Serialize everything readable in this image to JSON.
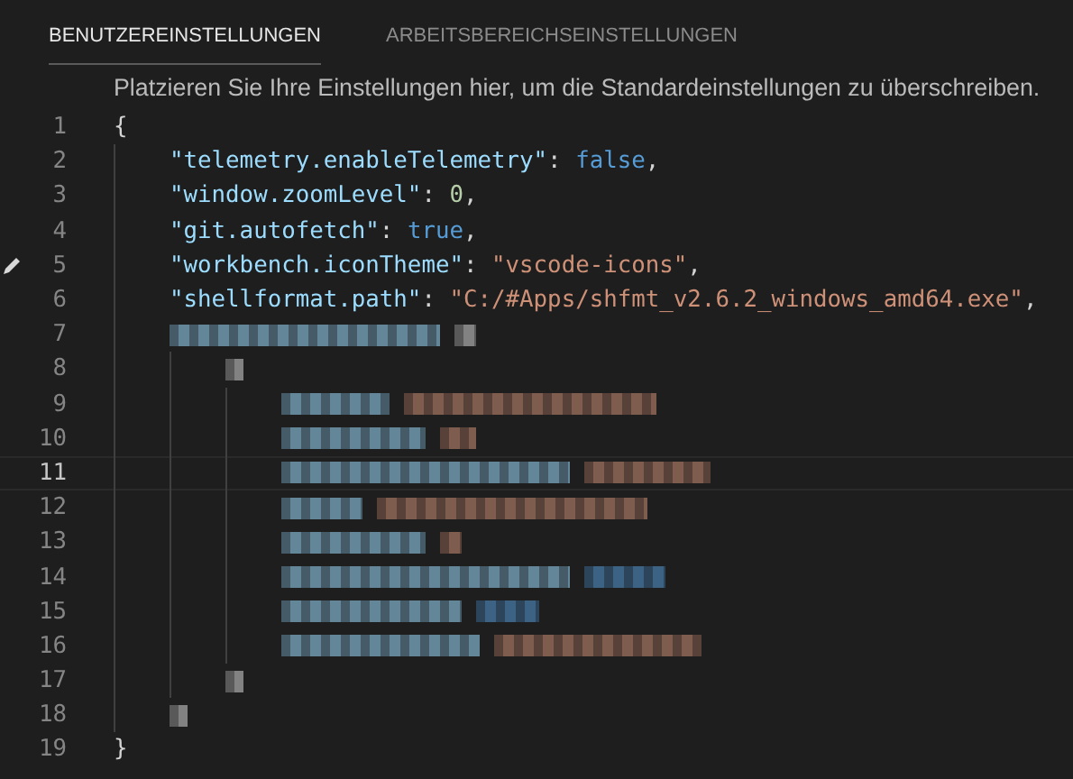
{
  "tabs": [
    {
      "label": "BENUTZEREINSTELLUNGEN",
      "selected": true
    },
    {
      "label": "ARBEITSBEREICHSEINSTELLUNGEN",
      "selected": false
    }
  ],
  "hint": "Platzieren Sie Ihre Einstellungen hier, um die Standardeinstellungen zu überschreiben.",
  "editor": {
    "lines": [
      {
        "number": "1",
        "kind": "code",
        "tokens": [
          {
            "kind": "punct",
            "text": "{"
          }
        ],
        "children": [
          {
            "number": "2",
            "kind": "code",
            "tokens": [
              {
                "kind": "key",
                "text": "\"telemetry.enableTelemetry\""
              },
              {
                "kind": "punct",
                "text": ": "
              },
              {
                "kind": "keyword",
                "text": "false"
              },
              {
                "kind": "punct",
                "text": ","
              }
            ]
          },
          {
            "number": "3",
            "kind": "code",
            "tokens": [
              {
                "kind": "key",
                "text": "\"window.zoomLevel\""
              },
              {
                "kind": "punct",
                "text": ": "
              },
              {
                "kind": "number",
                "text": "0"
              },
              {
                "kind": "punct",
                "text": ","
              }
            ]
          },
          {
            "number": "4",
            "kind": "code",
            "tokens": [
              {
                "kind": "key",
                "text": "\"git.autofetch\""
              },
              {
                "kind": "punct",
                "text": ": "
              },
              {
                "kind": "keyword",
                "text": "true"
              },
              {
                "kind": "punct",
                "text": ","
              }
            ]
          },
          {
            "number": "5",
            "kind": "code",
            "edit_icon": true,
            "tokens": [
              {
                "kind": "key",
                "text": "\"workbench.iconTheme\""
              },
              {
                "kind": "punct",
                "text": ": "
              },
              {
                "kind": "string",
                "text": "\"vscode-icons\""
              },
              {
                "kind": "punct",
                "text": ","
              }
            ]
          },
          {
            "number": "6",
            "kind": "code",
            "tokens": [
              {
                "kind": "key",
                "text": "\"shellformat.path\""
              },
              {
                "kind": "punct",
                "text": ": "
              },
              {
                "kind": "string",
                "text": "\"C:/#Apps/shfmt_v2.6.2_windows_amd64.exe\""
              },
              {
                "kind": "punct",
                "text": ","
              }
            ]
          },
          {
            "number": "7",
            "kind": "redacted",
            "blocks": [
              {
                "kind": "key"
              },
              {
                "kind": "punct"
              }
            ],
            "children": [
              {
                "number": "8",
                "kind": "redacted",
                "blocks": [
                  {
                    "kind": "punct"
                  }
                ],
                "children": [
                  {
                    "number": "9",
                    "kind": "redacted",
                    "blocks": [
                      {
                        "kind": "key"
                      },
                      {
                        "kind": "string"
                      }
                    ]
                  },
                  {
                    "number": "10",
                    "kind": "redacted",
                    "blocks": [
                      {
                        "kind": "key"
                      },
                      {
                        "kind": "string"
                      }
                    ]
                  },
                  {
                    "number": "11",
                    "kind": "redacted",
                    "current": true,
                    "blocks": [
                      {
                        "kind": "key"
                      },
                      {
                        "kind": "string"
                      }
                    ]
                  },
                  {
                    "number": "12",
                    "kind": "redacted",
                    "blocks": [
                      {
                        "kind": "key"
                      },
                      {
                        "kind": "string"
                      }
                    ]
                  },
                  {
                    "number": "13",
                    "kind": "redacted",
                    "blocks": [
                      {
                        "kind": "key"
                      },
                      {
                        "kind": "string"
                      }
                    ]
                  },
                  {
                    "number": "14",
                    "kind": "redacted",
                    "blocks": [
                      {
                        "kind": "key"
                      },
                      {
                        "kind": "keyword"
                      }
                    ]
                  },
                  {
                    "number": "15",
                    "kind": "redacted",
                    "blocks": [
                      {
                        "kind": "key"
                      },
                      {
                        "kind": "keyword"
                      }
                    ]
                  },
                  {
                    "number": "16",
                    "kind": "redacted",
                    "blocks": [
                      {
                        "kind": "key"
                      },
                      {
                        "kind": "string"
                      }
                    ]
                  }
                ]
              },
              {
                "number": "17",
                "kind": "redacted",
                "blocks": [
                  {
                    "kind": "punct"
                  }
                ]
              }
            ]
          },
          {
            "number": "18",
            "kind": "redacted",
            "blocks": [
              {
                "kind": "punct"
              }
            ]
          }
        ]
      },
      {
        "number": "19",
        "kind": "code",
        "tokens": [
          {
            "kind": "punct",
            "text": "}"
          }
        ]
      }
    ]
  }
}
